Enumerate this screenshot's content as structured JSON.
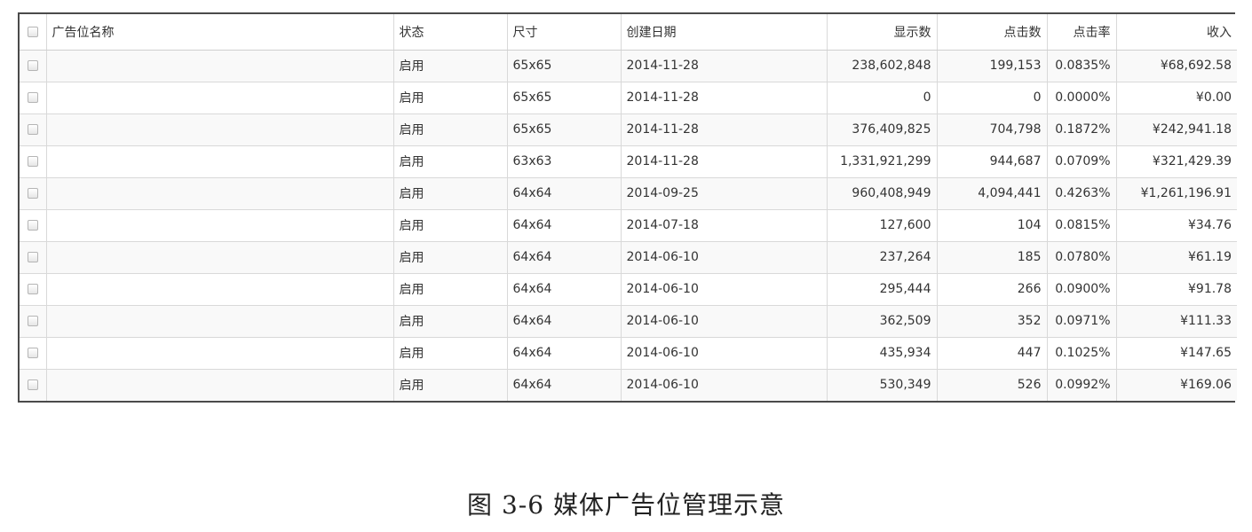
{
  "table": {
    "headers": {
      "name": "广告位名称",
      "status": "状态",
      "size": "尺寸",
      "date": "创建日期",
      "shows": "显示数",
      "clicks": "点击数",
      "ctr": "点击率",
      "income": "收入"
    },
    "rows": [
      {
        "name": "",
        "status": "启用",
        "size": "65x65",
        "date": "2014-11-28",
        "shows": "238,602,848",
        "clicks": "199,153",
        "ctr": "0.0835%",
        "income": "¥68,692.58"
      },
      {
        "name": "",
        "status": "启用",
        "size": "65x65",
        "date": "2014-11-28",
        "shows": "0",
        "clicks": "0",
        "ctr": "0.0000%",
        "income": "¥0.00"
      },
      {
        "name": "",
        "status": "启用",
        "size": "65x65",
        "date": "2014-11-28",
        "shows": "376,409,825",
        "clicks": "704,798",
        "ctr": "0.1872%",
        "income": "¥242,941.18"
      },
      {
        "name": "",
        "status": "启用",
        "size": "63x63",
        "date": "2014-11-28",
        "shows": "1,331,921,299",
        "clicks": "944,687",
        "ctr": "0.0709%",
        "income": "¥321,429.39"
      },
      {
        "name": "",
        "status": "启用",
        "size": "64x64",
        "date": "2014-09-25",
        "shows": "960,408,949",
        "clicks": "4,094,441",
        "ctr": "0.4263%",
        "income": "¥1,261,196.91"
      },
      {
        "name": "",
        "status": "启用",
        "size": "64x64",
        "date": "2014-07-18",
        "shows": "127,600",
        "clicks": "104",
        "ctr": "0.0815%",
        "income": "¥34.76"
      },
      {
        "name": "",
        "status": "启用",
        "size": "64x64",
        "date": "2014-06-10",
        "shows": "237,264",
        "clicks": "185",
        "ctr": "0.0780%",
        "income": "¥61.19"
      },
      {
        "name": "",
        "status": "启用",
        "size": "64x64",
        "date": "2014-06-10",
        "shows": "295,444",
        "clicks": "266",
        "ctr": "0.0900%",
        "income": "¥91.78"
      },
      {
        "name": "",
        "status": "启用",
        "size": "64x64",
        "date": "2014-06-10",
        "shows": "362,509",
        "clicks": "352",
        "ctr": "0.0971%",
        "income": "¥111.33"
      },
      {
        "name": "",
        "status": "启用",
        "size": "64x64",
        "date": "2014-06-10",
        "shows": "435,934",
        "clicks": "447",
        "ctr": "0.1025%",
        "income": "¥147.65"
      },
      {
        "name": "",
        "status": "启用",
        "size": "64x64",
        "date": "2014-06-10",
        "shows": "530,349",
        "clicks": "526",
        "ctr": "0.0992%",
        "income": "¥169.06"
      }
    ]
  },
  "caption": "图 3-6  媒体广告位管理示意",
  "colors": {
    "border": "#4a4a4a",
    "gridline": "#d9d9d9",
    "row_alt": "#f9f9f9",
    "text": "#333333"
  }
}
